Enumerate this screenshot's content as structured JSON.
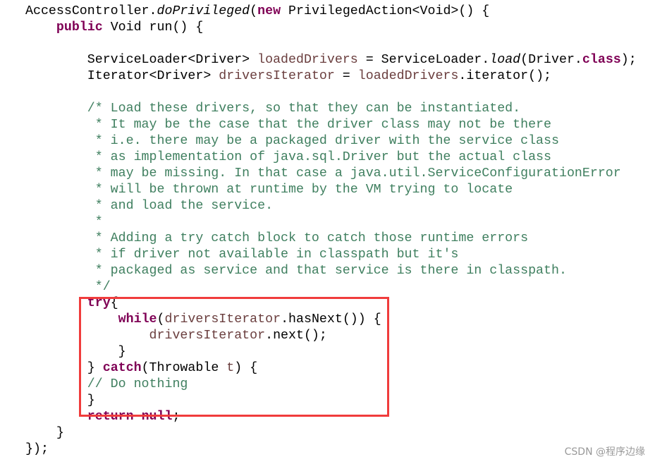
{
  "code_lines": [
    [
      [
        "n",
        "AccessController."
      ],
      [
        "it",
        "doPrivileged"
      ],
      [
        "n",
        "("
      ],
      [
        "kw",
        "new"
      ],
      [
        "n",
        " PrivilegedAction<Void>() {"
      ]
    ],
    [
      [
        "n",
        "    "
      ],
      [
        "kw",
        "public"
      ],
      [
        "n",
        " Void run() {"
      ]
    ],
    [],
    [
      [
        "n",
        "        ServiceLoader<Driver> "
      ],
      [
        "var",
        "loadedDrivers"
      ],
      [
        "n",
        " = ServiceLoader."
      ],
      [
        "it",
        "load"
      ],
      [
        "n",
        "(Driver."
      ],
      [
        "kw",
        "class"
      ],
      [
        "n",
        ");"
      ]
    ],
    [
      [
        "n",
        "        Iterator<Driver> "
      ],
      [
        "var",
        "driversIterator"
      ],
      [
        "n",
        " = "
      ],
      [
        "var",
        "loadedDrivers"
      ],
      [
        "n",
        ".iterator();"
      ]
    ],
    [],
    [
      [
        "cm",
        "        /* Load these drivers, so that they can be instantiated."
      ]
    ],
    [
      [
        "cm",
        "         * It may be the case that the driver class may not be there"
      ]
    ],
    [
      [
        "cm",
        "         * i.e. there may be a packaged driver with the service class"
      ]
    ],
    [
      [
        "cm",
        "         * as implementation of java.sql.Driver but the actual class"
      ]
    ],
    [
      [
        "cm",
        "         * may be missing. In that case a java.util.ServiceConfigurationError"
      ]
    ],
    [
      [
        "cm",
        "         * will be thrown at runtime by the VM trying to locate"
      ]
    ],
    [
      [
        "cm",
        "         * and load the service."
      ]
    ],
    [
      [
        "cm",
        "         *"
      ]
    ],
    [
      [
        "cm",
        "         * Adding a try catch block to catch those runtime errors"
      ]
    ],
    [
      [
        "cm",
        "         * if driver not available in classpath but it's"
      ]
    ],
    [
      [
        "cm",
        "         * packaged as service and that service is there in classpath."
      ]
    ],
    [
      [
        "cm",
        "         */"
      ]
    ],
    [
      [
        "n",
        "        "
      ],
      [
        "kw",
        "try"
      ],
      [
        "n",
        "{"
      ]
    ],
    [
      [
        "n",
        "            "
      ],
      [
        "kw",
        "while"
      ],
      [
        "n",
        "("
      ],
      [
        "var",
        "driversIterator"
      ],
      [
        "n",
        ".hasNext()) {"
      ]
    ],
    [
      [
        "n",
        "                "
      ],
      [
        "var",
        "driversIterator"
      ],
      [
        "n",
        ".next();"
      ]
    ],
    [
      [
        "n",
        "            }"
      ]
    ],
    [
      [
        "n",
        "        } "
      ],
      [
        "kw",
        "catch"
      ],
      [
        "n",
        "(Throwable "
      ],
      [
        "var",
        "t"
      ],
      [
        "n",
        ") {"
      ]
    ],
    [
      [
        "cm",
        "        // Do nothing"
      ]
    ],
    [
      [
        "n",
        "        }"
      ]
    ],
    [
      [
        "n",
        "        "
      ],
      [
        "kw",
        "return"
      ],
      [
        "n",
        " "
      ],
      [
        "kw",
        "null"
      ],
      [
        "n",
        ";"
      ]
    ],
    [
      [
        "n",
        "    }"
      ]
    ],
    [
      [
        "n",
        "});"
      ]
    ]
  ],
  "highlight_color": "#f03c3c",
  "watermark": "CSDN @程序边缘"
}
